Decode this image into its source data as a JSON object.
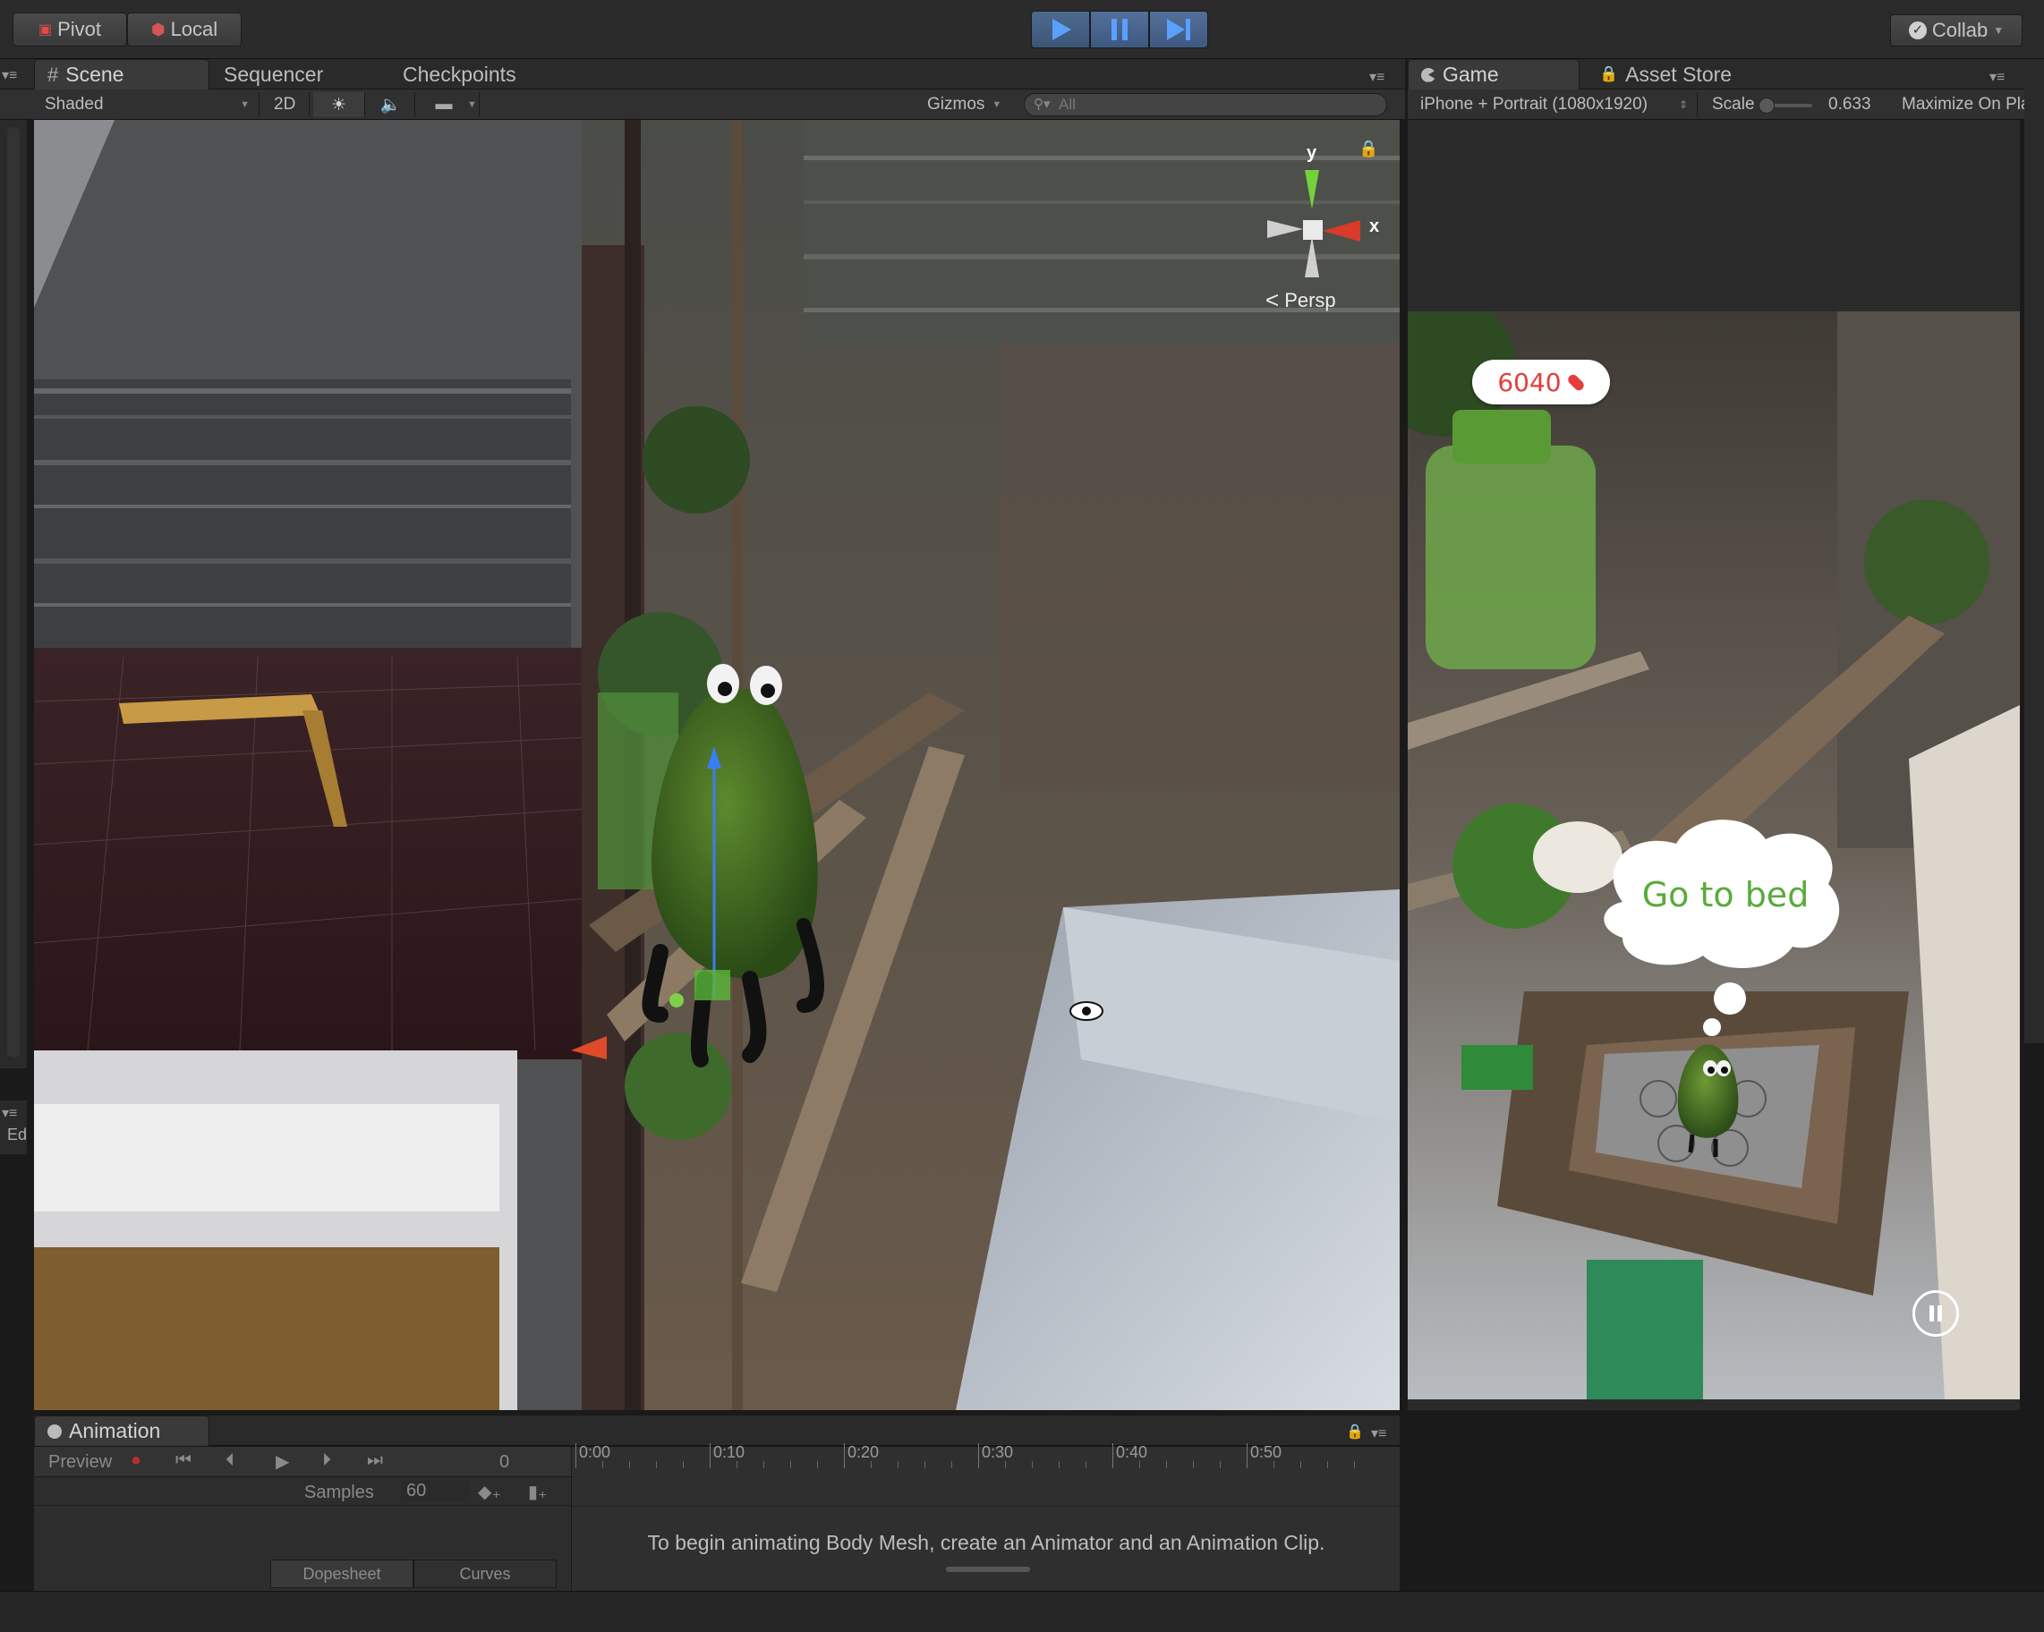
{
  "toolbar": {
    "pivot_label": "Pivot",
    "local_label": "Local",
    "collab_label": "Collab"
  },
  "scene_panel": {
    "tabs": [
      {
        "label": "Scene",
        "icon": "grid-icon",
        "active": true
      },
      {
        "label": "Sequencer",
        "active": false
      },
      {
        "label": "Checkpoints",
        "active": false
      }
    ],
    "shading_mode": "Shaded",
    "mode_2d_label": "2D",
    "gizmos_label": "Gizmos",
    "search_placeholder": "All",
    "persp_label": "Persp",
    "axis_y_label": "y",
    "axis_x_label": "x"
  },
  "game_panel": {
    "tabs": [
      {
        "label": "Game",
        "icon": "pacman-icon",
        "active": true
      },
      {
        "label": "Asset Store",
        "icon": "lock-icon",
        "active": false
      }
    ],
    "resolution": "iPhone + Portrait (1080x1920)",
    "scale_label": "Scale",
    "scale_value": "0.633",
    "scale_fraction": 0.05,
    "maximize_label": "Maximize On Pla",
    "score": "6040",
    "bubble_text": "Go to bed"
  },
  "left_sidebar": {
    "label": "Ed"
  },
  "animation_panel": {
    "tab_label": "Animation",
    "preview_label": "Preview",
    "frame_value": "0",
    "samples_label": "Samples",
    "samples_value": "60",
    "timeline_ticks": [
      "0:00",
      "0:10",
      "0:20",
      "0:30",
      "0:40",
      "0:50"
    ],
    "message": "To begin animating Body Mesh, create an Animator and an Animation Clip.",
    "bottom_tabs": [
      "Dopesheet",
      "Curves"
    ]
  },
  "colors": {
    "play_blue": "#5aa0ff",
    "score_red": "#e63c3c",
    "bubble_green": "#5aaa3c",
    "axis_x": "#d93a2a",
    "axis_y": "#72d23a"
  }
}
